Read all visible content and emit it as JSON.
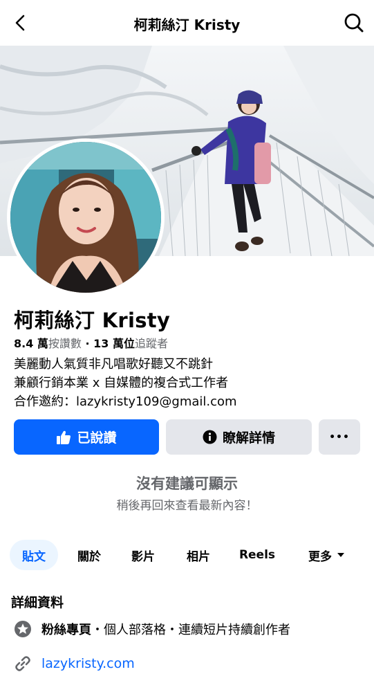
{
  "header": {
    "title": "柯莉絲汀 Kristy",
    "back_icon": "chevron-left-icon",
    "search_icon": "search-icon"
  },
  "profile": {
    "name": "柯莉絲汀 Kristy",
    "likes_count": "8.4 萬",
    "likes_label": "按讚數",
    "separator": " · ",
    "followers_count": "13 萬",
    "followers_unit": "位",
    "followers_label": "追蹤者",
    "bio": [
      "美麗動人氣質非凡唱歌好聽又不跳針",
      "兼顧行銷本業 x 自媒體的複合式工作者",
      "合作邀約：lazykristy109@gmail.com"
    ]
  },
  "actions": {
    "liked_label": "已說讚",
    "info_label": "瞭解詳情",
    "more_label": "•••"
  },
  "suggestions": {
    "title": "沒有建議可顯示",
    "subtitle": "稍後再回來查看最新內容！"
  },
  "tabs": [
    {
      "label": "貼文",
      "active": true
    },
    {
      "label": "關於",
      "active": false
    },
    {
      "label": "影片",
      "active": false
    },
    {
      "label": "相片",
      "active": false
    },
    {
      "label": "Reels",
      "active": false
    },
    {
      "label": "更多",
      "active": false
    }
  ],
  "details": {
    "title": "詳細資料",
    "page_type_bold": "粉絲專頁",
    "page_type_rest": "・個人部落格・連續短片持續創作者",
    "website": "lazykristy.com"
  },
  "colors": {
    "accent": "#0866ff",
    "secondary_button": "#e4e6eb",
    "muted_text": "#65676b",
    "active_tab_bg": "#ebf5ff"
  }
}
